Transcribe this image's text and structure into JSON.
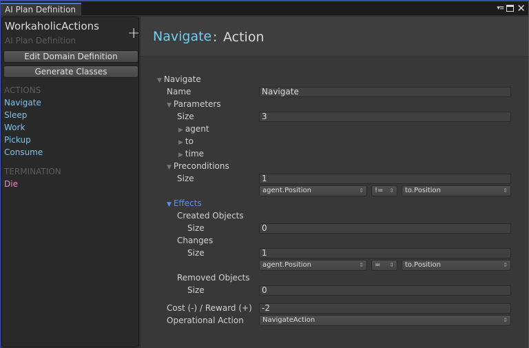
{
  "window": {
    "tab_title": "AI Plan Definition",
    "controls": {
      "menu_icon": "dropdown-menu-icon",
      "maximize_icon": "maximize-icon",
      "close_icon": "close-icon"
    }
  },
  "sidebar": {
    "title": "WorkaholicActions",
    "subtitle": "AI Plan Definition",
    "add_icon": "plus-icon",
    "buttons": [
      {
        "label": "Edit Domain Definition"
      },
      {
        "label": "Generate Classes"
      }
    ],
    "sections": [
      {
        "title": "ACTIONS",
        "items": [
          "Navigate",
          "Sleep",
          "Work",
          "Pickup",
          "Consume"
        ]
      },
      {
        "title": "TERMINATION",
        "items": [
          "Die"
        ]
      }
    ]
  },
  "main": {
    "header": {
      "name": "Navigate",
      "separator": ":",
      "type": "Action"
    },
    "inspector": {
      "root_label": "Navigate",
      "name_label": "Name",
      "name_value": "Navigate",
      "parameters": {
        "label": "Parameters",
        "size_label": "Size",
        "size_value": "3",
        "items": [
          "agent",
          "to",
          "time"
        ]
      },
      "preconditions": {
        "label": "Preconditions",
        "size_label": "Size",
        "size_value": "1",
        "rows": [
          {
            "left": "agent.Position",
            "op": "!=",
            "right": "to.Position"
          }
        ]
      },
      "effects": {
        "label": "Effects",
        "created": {
          "label": "Created Objects",
          "size_label": "Size",
          "size_value": "0"
        },
        "changes": {
          "label": "Changes",
          "size_label": "Size",
          "size_value": "1",
          "rows": [
            {
              "left": "agent.Position",
              "op": "=",
              "right": "to.Position"
            }
          ]
        },
        "removed": {
          "label": "Removed Objects",
          "size_label": "Size",
          "size_value": "0"
        }
      },
      "cost_label": "Cost (-) / Reward (+)",
      "cost_value": "-2",
      "operational_label": "Operational Action",
      "operational_value": "NavigateAction"
    }
  },
  "colors": {
    "action_item": "#7cc4e8",
    "termination_item": "#e58cc4",
    "header_name": "#6ecfee",
    "effects_label": "#5c8ef0",
    "window_border": "#3a4fa8"
  }
}
